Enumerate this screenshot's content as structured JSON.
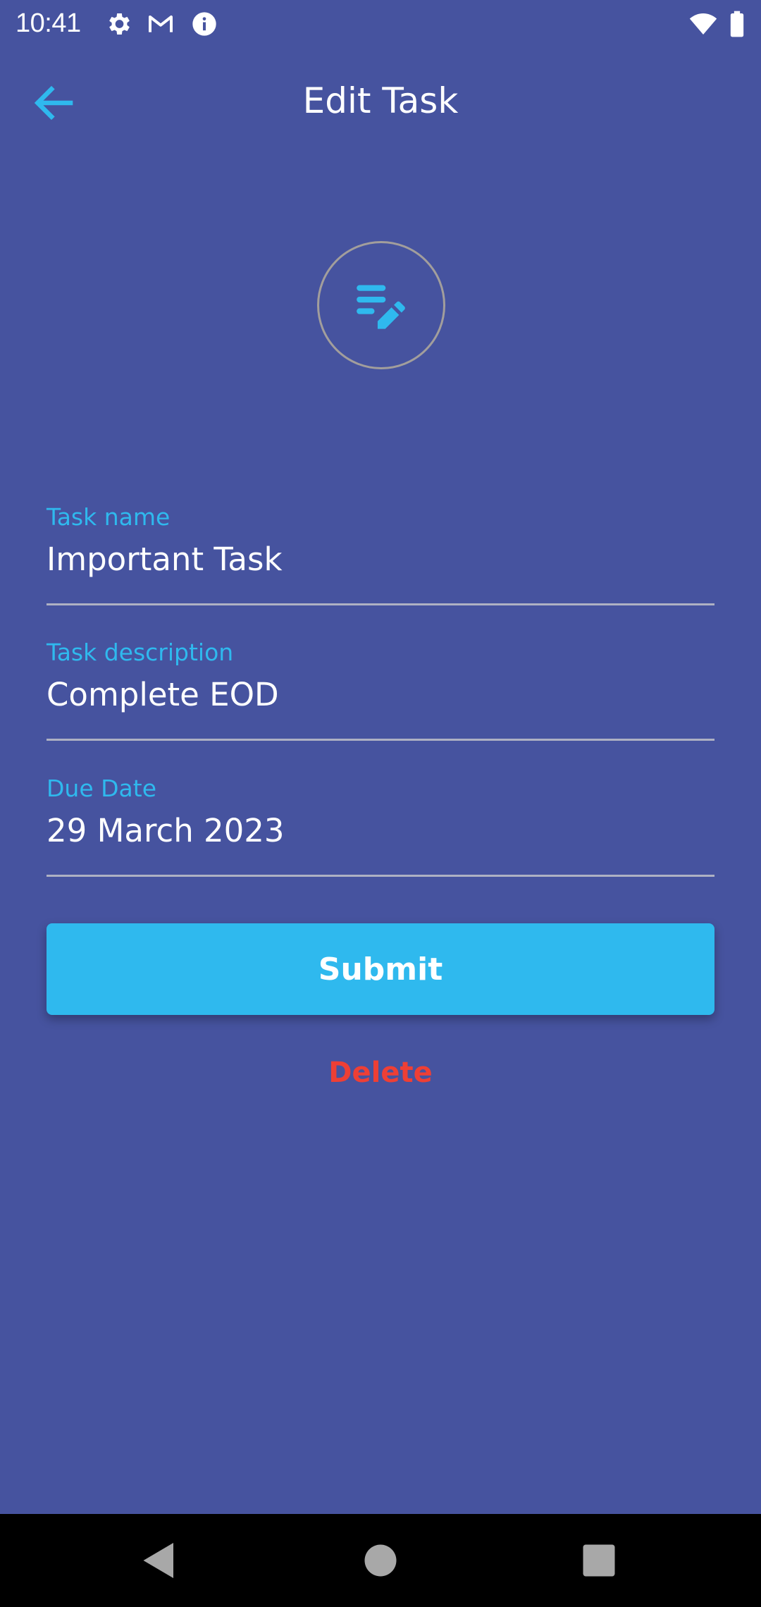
{
  "status_bar": {
    "time": "10:41",
    "icons": [
      "gear-icon",
      "gmail-icon",
      "info-icon",
      "wifi-icon",
      "battery-icon"
    ]
  },
  "app_bar": {
    "title": "Edit Task",
    "back_icon": "arrow-back-icon"
  },
  "header_icon": "edit-note-icon",
  "form": {
    "task_name": {
      "label": "Task name",
      "value": "Important Task"
    },
    "task_description": {
      "label": "Task description",
      "value": "Complete EOD"
    },
    "due_date": {
      "label": "Due Date",
      "value": "29 March 2023"
    }
  },
  "actions": {
    "submit_label": "Submit",
    "delete_label": "Delete"
  },
  "nav_bar": {
    "icons": [
      "back-triangle-icon",
      "home-circle-icon",
      "recents-square-icon"
    ]
  },
  "colors": {
    "background": "#46539f",
    "accent": "#2fb9ee",
    "danger": "#ee3f35",
    "text": "#ffffff"
  }
}
